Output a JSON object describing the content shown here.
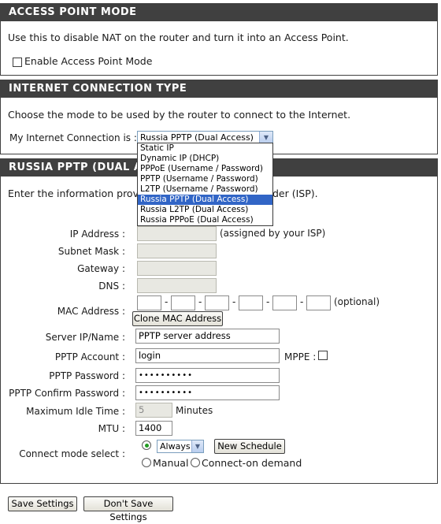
{
  "access_point": {
    "header": "ACCESS POINT MODE",
    "description": "Use this to disable NAT on the router and turn it into an Access Point.",
    "enable_label": "Enable Access Point Mode"
  },
  "connection_type": {
    "header": "INTERNET CONNECTION TYPE",
    "description": "Choose the mode to be used by the router to connect to the Internet.",
    "my_connection_label": "My Internet Connection is :",
    "selected": "Russia PPTP (Dual Access)",
    "options": [
      "Static IP",
      "Dynamic IP (DHCP)",
      "PPPoE (Username / Password)",
      "PPTP (Username / Password)",
      "L2TP (Username / Password)",
      "Russia PPTP (Dual Access)",
      "Russia L2TP (Dual Access)",
      "Russia PPPoE (Dual Access)"
    ]
  },
  "russia_pptp": {
    "header": "RUSSIA PPTP (DUAL AC",
    "description_start": "Enter the information provide",
    "description_end": "der (ISP).",
    "ip_label": "IP Address :",
    "ip_note": "(assigned by your ISP)",
    "subnet_label": "Subnet Mask :",
    "gateway_label": "Gateway :",
    "dns_label": "DNS :",
    "mac_label": "MAC Address :",
    "mac_note": "(optional)",
    "clone_mac_button": "Clone MAC Address",
    "server_label": "Server IP/Name :",
    "server_value": "PPTP server address",
    "account_label": "PPTP Account :",
    "account_value": "login",
    "mppe_label": "MPPE :",
    "password_label": "PPTP Password :",
    "password_value": "••••••••••",
    "confirm_label": "PPTP Confirm Password :",
    "confirm_value": "••••••••••",
    "idle_label": "Maximum Idle Time :",
    "idle_value": "5",
    "idle_unit": "Minutes",
    "mtu_label": "MTU :",
    "mtu_value": "1400",
    "connect_label": "Connect mode select :",
    "schedule_value": "Always",
    "new_schedule_button": "New Schedule",
    "manual_label": "Manual",
    "on_demand_label": "Connect-on demand"
  },
  "footer": {
    "save_button": "Save Settings",
    "dont_save_button": "Don't Save Settings"
  }
}
